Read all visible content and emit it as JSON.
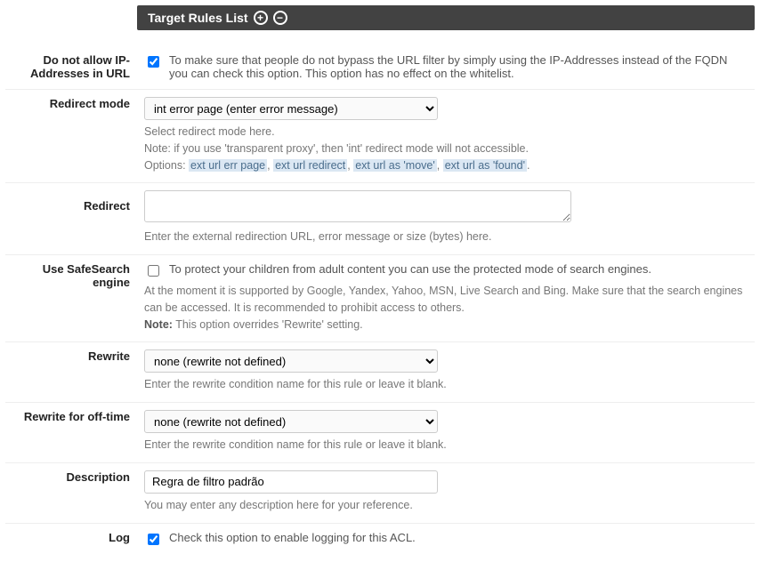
{
  "header": {
    "title": "Target Rules List"
  },
  "rows": {
    "noip": {
      "label": "Do not allow IP-Addresses in URL",
      "checked": true,
      "text": "To make sure that people do not bypass the URL filter by simply using the IP-Addresses instead of the FQDN you can check this option. This option has no effect on the whitelist."
    },
    "redirect_mode": {
      "label": "Redirect mode",
      "selected": "int error page (enter error message)",
      "help1": "Select redirect mode here.",
      "help2": "Note: if you use 'transparent proxy', then 'int' redirect mode will not accessible.",
      "help3_prefix": "Options:",
      "options": [
        "ext url err page",
        "ext url redirect",
        "ext url as 'move'",
        "ext url as 'found'"
      ]
    },
    "redirect": {
      "label": "Redirect",
      "value": "",
      "help": "Enter the external redirection URL, error message or size (bytes) here."
    },
    "safesearch": {
      "label": "Use SafeSearch engine",
      "checked": false,
      "text": "To protect your children from adult content you can use the protected mode of search engines.",
      "help": "At the moment it is supported by Google, Yandex, Yahoo, MSN, Live Search and Bing. Make sure that the search engines can be accessed. It is recommended to prohibit access to others.",
      "note_label": "Note:",
      "note_text": " This option overrides 'Rewrite' setting."
    },
    "rewrite": {
      "label": "Rewrite",
      "selected": "none (rewrite not defined)",
      "help": "Enter the rewrite condition name for this rule or leave it blank."
    },
    "rewrite_off": {
      "label": "Rewrite for off-time",
      "selected": "none (rewrite not defined)",
      "help": "Enter the rewrite condition name for this rule or leave it blank."
    },
    "description": {
      "label": "Description",
      "value": "Regra de filtro padrão",
      "help": "You may enter any description here for your reference."
    },
    "log": {
      "label": "Log",
      "checked": true,
      "text": "Check this option to enable logging for this ACL."
    }
  }
}
